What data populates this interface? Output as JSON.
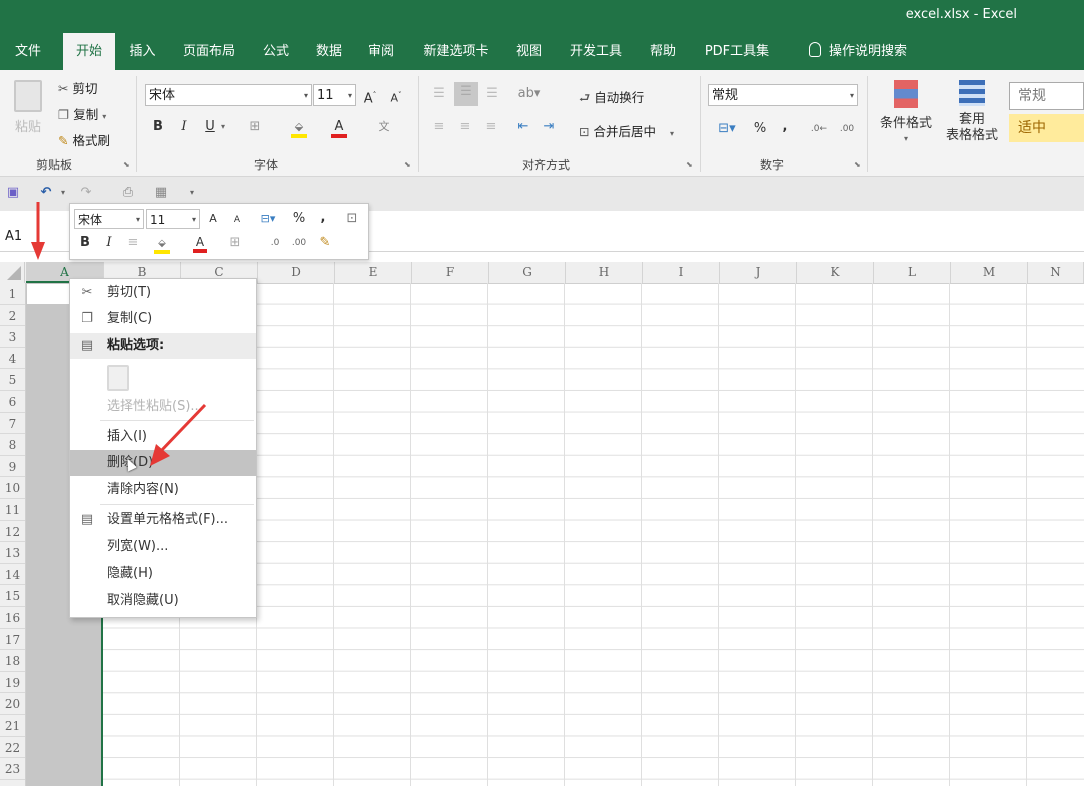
{
  "window": {
    "title": "excel.xlsx  -  Excel"
  },
  "ribbon_tabs": [
    "文件",
    "开始",
    "插入",
    "页面布局",
    "公式",
    "数据",
    "审阅",
    "新建选项卡",
    "视图",
    "开发工具",
    "帮助",
    "PDF工具集"
  ],
  "tell_me": "操作说明搜索",
  "clipboard": {
    "paste": "粘贴",
    "cut": "剪切",
    "copy": "复制",
    "format_painter": "格式刷",
    "group": "剪贴板"
  },
  "font": {
    "name": "宋体",
    "size": "11",
    "bold": "B",
    "italic": "I",
    "underline": "U",
    "group": "字体"
  },
  "alignment": {
    "wrap_text": "自动换行",
    "merge_center": "合并后居中",
    "group": "对齐方式"
  },
  "number": {
    "format": "常规",
    "percent": "%",
    "comma": ",",
    "group": "数字"
  },
  "styles": {
    "conditional": "条件格式",
    "table_line1": "套用",
    "table_line2": "表格格式",
    "style_normal": "常规",
    "style_neutral": "适中"
  },
  "name_box": "A1",
  "columns": [
    "A",
    "B",
    "C",
    "D",
    "E",
    "F",
    "G",
    "H",
    "I",
    "J",
    "K",
    "L",
    "M",
    "N"
  ],
  "rows": [
    "1",
    "2",
    "3",
    "4",
    "5",
    "6",
    "7",
    "8",
    "9",
    "10",
    "11",
    "12",
    "13",
    "14",
    "15",
    "16",
    "17",
    "18",
    "19",
    "20",
    "21",
    "22",
    "23"
  ],
  "mini_toolbar": {
    "font": "宋体",
    "size": "11",
    "bold": "B",
    "italic": "I",
    "percent": "%",
    "comma": ","
  },
  "context_menu": {
    "cut": "剪切(T)",
    "copy": "复制(C)",
    "paste_options": "粘贴选项:",
    "paste_special": "选择性粘贴(S)...",
    "insert": "插入(I)",
    "delete": "删除(D)",
    "clear": "清除内容(N)",
    "format_cells": "设置单元格格式(F)...",
    "column_width": "列宽(W)...",
    "hide": "隐藏(H)",
    "unhide": "取消隐藏(U)"
  },
  "colors": {
    "excel_green": "#217346",
    "arrow_red": "#e53935"
  }
}
